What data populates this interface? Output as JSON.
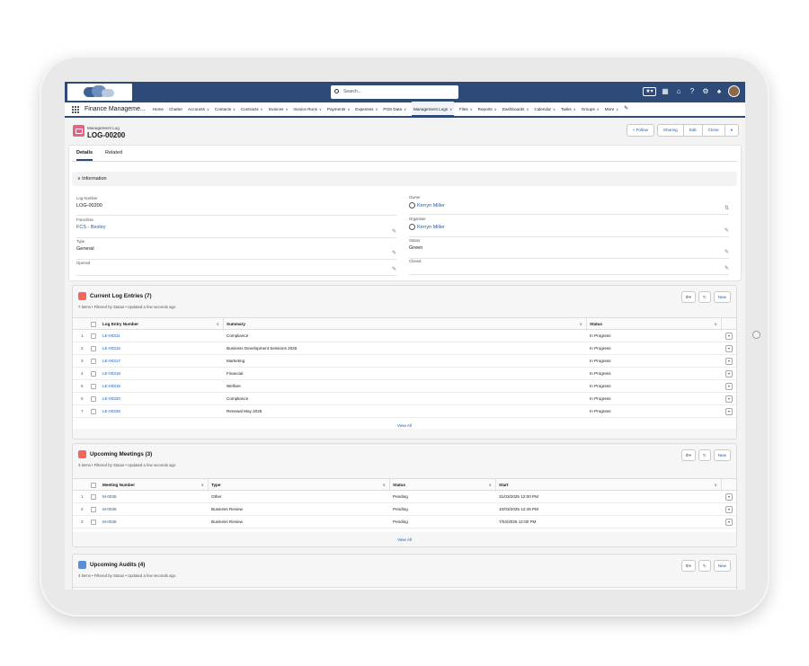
{
  "header": {
    "search_placeholder": "Search...",
    "app_name": "Finance Manageme...",
    "fav_label": "★▾"
  },
  "nav": [
    {
      "label": "Home",
      "chevron": false
    },
    {
      "label": "Chatter",
      "chevron": false
    },
    {
      "label": "Accounts",
      "chevron": true
    },
    {
      "label": "Contacts",
      "chevron": true
    },
    {
      "label": "Contracts",
      "chevron": true
    },
    {
      "label": "Invoices",
      "chevron": true
    },
    {
      "label": "Invoice Runs",
      "chevron": true
    },
    {
      "label": "Payments",
      "chevron": true
    },
    {
      "label": "Expenses",
      "chevron": true
    },
    {
      "label": "POS Data",
      "chevron": true
    },
    {
      "label": "Management Logs",
      "chevron": true
    },
    {
      "label": "Files",
      "chevron": true
    },
    {
      "label": "Reports",
      "chevron": true
    },
    {
      "label": "Dashboards",
      "chevron": true
    },
    {
      "label": "Calendar",
      "chevron": true
    },
    {
      "label": "Tasks",
      "chevron": true
    },
    {
      "label": "Groups",
      "chevron": true
    },
    {
      "label": "More",
      "chevron": true
    }
  ],
  "record": {
    "type": "Management Log",
    "name": "LOG-00200",
    "buttons": {
      "follow": "+ Follow",
      "sharing": "Sharing",
      "edit": "Edit",
      "clone": "Clone",
      "menu": "▾"
    }
  },
  "tabs": {
    "details": "Details",
    "related": "Related"
  },
  "section_title": "Information",
  "fields": {
    "log_number": {
      "label": "Log Number",
      "value": "LOG-00200"
    },
    "owner": {
      "label": "Owner",
      "value": "Kerryn Miller"
    },
    "franchise": {
      "label": "Franchise",
      "value": "FCS - Bexley"
    },
    "organiser": {
      "label": "Organiser",
      "value": "Kerryn Miller"
    },
    "type": {
      "label": "Type",
      "value": "General"
    },
    "status": {
      "label": "Status",
      "value": "Green"
    },
    "opened": {
      "label": "Opened",
      "value": ""
    },
    "closed": {
      "label": "Closed",
      "value": ""
    }
  },
  "log_entries": {
    "title": "Current Log Entries (7)",
    "subtitle": "7 items • Filtered by Status • Updated a few seconds ago",
    "new_label": "New",
    "columns": [
      "Log Entry Number",
      "Summary",
      "Status"
    ],
    "rows": [
      {
        "n": "1",
        "id": "LE-00311",
        "summary": "Compliance",
        "status": "In Progress"
      },
      {
        "n": "2",
        "id": "LE-00315",
        "summary": "Business Development Sessions 2025",
        "status": "In Progress"
      },
      {
        "n": "3",
        "id": "LE-00317",
        "summary": "Marketing",
        "status": "In Progress"
      },
      {
        "n": "4",
        "id": "LE-00318",
        "summary": "Financial",
        "status": "In Progress"
      },
      {
        "n": "5",
        "id": "LE-00319",
        "summary": "Welfare",
        "status": "In Progress"
      },
      {
        "n": "6",
        "id": "LE-00320",
        "summary": "Compliance",
        "status": "In Progress"
      },
      {
        "n": "7",
        "id": "LE-00326",
        "summary": "Renewal May 2025",
        "status": "In Progress"
      }
    ],
    "view_all": "View All"
  },
  "meetings": {
    "title": "Upcoming Meetings (3)",
    "subtitle": "3 items • Filtered by Status • Updated a few seconds ago",
    "new_label": "New",
    "columns": [
      "Meeting Number",
      "Type",
      "Status",
      "Start"
    ],
    "rows": [
      {
        "n": "1",
        "id": "M-0035",
        "type": "Other",
        "status": "Pending",
        "start": "31/03/2025 12:00 PM"
      },
      {
        "n": "2",
        "id": "M-0036",
        "type": "Business Review",
        "status": "Pending",
        "start": "10/03/2025 12:45 PM"
      },
      {
        "n": "3",
        "id": "M-0038",
        "type": "Business Review",
        "status": "Pending",
        "start": "7/04/2025 12:00 PM"
      }
    ],
    "view_all": "View All"
  },
  "audits": {
    "title": "Upcoming Audits (4)",
    "subtitle": "4 items • Filtered by Status • Updated a few seconds ago",
    "new_label": "New"
  },
  "colors": {
    "brand": "#2e4a78",
    "link": "#1b5fb3",
    "log_icon": "#e26484",
    "entries_icon": "#f2665e",
    "meetings_icon": "#f2665e",
    "audits_icon": "#5a8fd8"
  }
}
